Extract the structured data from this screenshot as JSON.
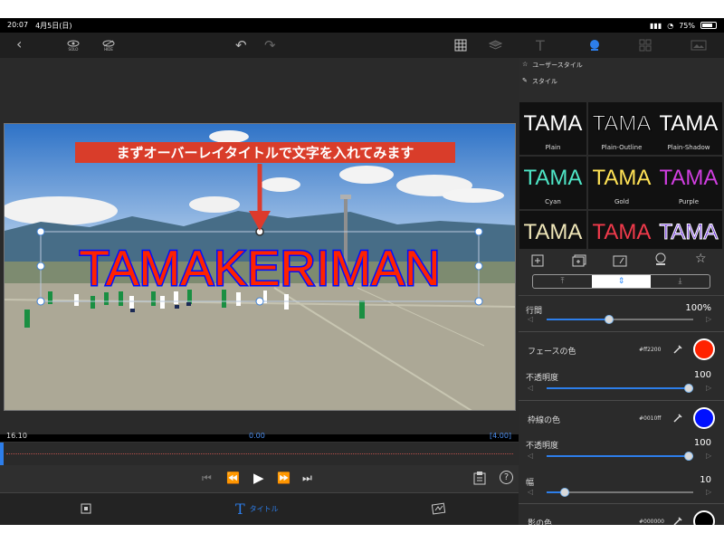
{
  "status": {
    "time": "20:07",
    "date": "4月5日(日)",
    "battery": "75%"
  },
  "toolbar": {
    "solo": "SOLO",
    "hide": "HIDE",
    "text_icon": "T"
  },
  "preview": {
    "caption": "まずオーバーレイタイトルで文字を入れてみます",
    "title": "TAMAKERIMAN"
  },
  "timeline": {
    "left": "16.10",
    "center": "0.00",
    "right": "[4.00]"
  },
  "bottom": {
    "tab_title": "タイトル"
  },
  "panel": {
    "user_styles": "ユーザースタイル",
    "styles": "スタイル",
    "styles_grid": [
      {
        "label": "Plain",
        "sample": "TAMA"
      },
      {
        "label": "Plain-Outline",
        "sample": "TAMA"
      },
      {
        "label": "Plain-Shadow",
        "sample": "TAMA"
      },
      {
        "label": "Cyan",
        "sample": "TAMA"
      },
      {
        "label": "Gold",
        "sample": "TAMA"
      },
      {
        "label": "Purple",
        "sample": "TAMA"
      },
      {
        "label": "",
        "sample": "TAMA"
      },
      {
        "label": "",
        "sample": "TAMA"
      },
      {
        "label": "",
        "sample": "TAMA"
      }
    ],
    "line_spacing_label": "行間",
    "line_spacing_value": "100%",
    "face_color_label": "フェースの色",
    "face_color_hex": "#ff2200",
    "face_opacity_label": "不透明度",
    "face_opacity_value": "100",
    "stroke_color_label": "枠線の色",
    "stroke_color_hex": "#0010ff",
    "stroke_opacity_label": "不透明度",
    "stroke_opacity_value": "100",
    "width_label": "幅",
    "width_value": "10",
    "shadow_color_label": "影の色",
    "shadow_color_hex": "#000000"
  },
  "colors": {
    "face": "#ff2200",
    "stroke": "#0010ff",
    "shadow": "#000000",
    "accent": "#2d7eea"
  },
  "levels": {
    "line_spacing": 0.42,
    "face_opacity": 1.0,
    "stroke_opacity": 1.0,
    "width": 0.1
  }
}
